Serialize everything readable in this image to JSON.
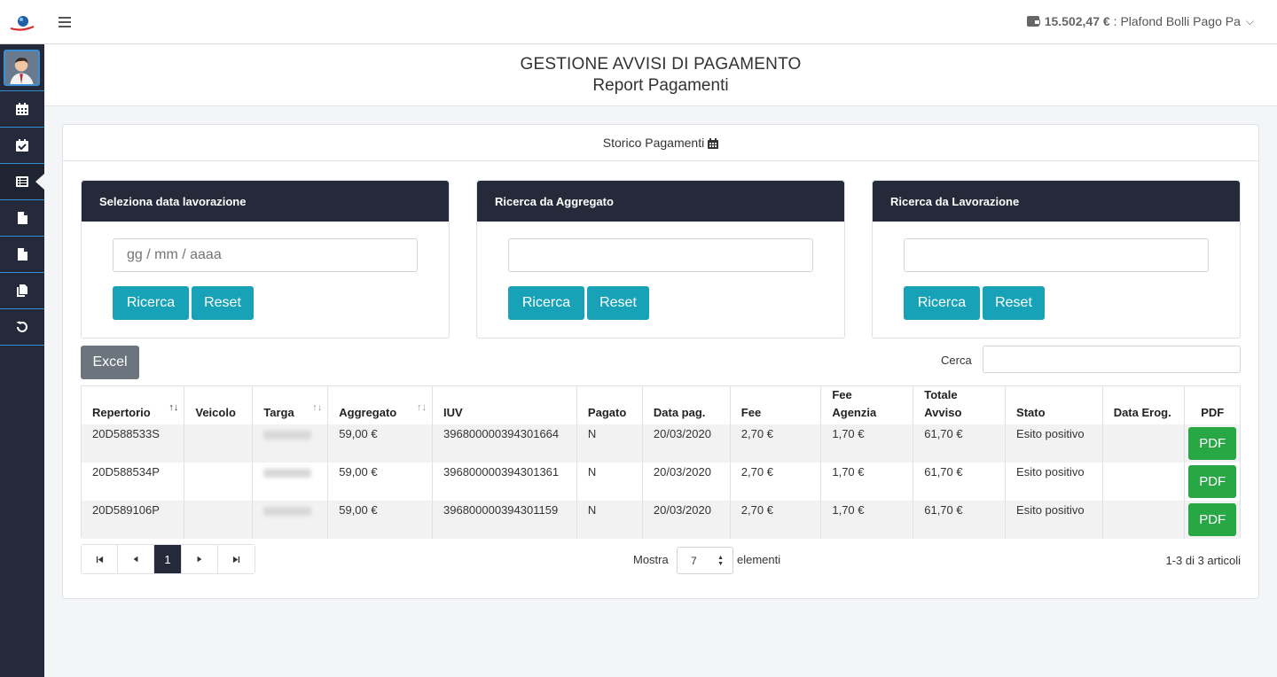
{
  "topbar": {
    "amount": "15.502,47 €",
    "plafond_label": ": Plafond Bolli Pago Pa",
    "menu_icon": "hamburger-icon",
    "wallet_icon": "wallet-icon"
  },
  "sidebar": {
    "items": [
      {
        "icon": "calendar-icon"
      },
      {
        "icon": "calendar-check-icon"
      },
      {
        "icon": "list-icon",
        "active": true
      },
      {
        "icon": "file-icon"
      },
      {
        "icon": "file-icon"
      },
      {
        "icon": "copy-icon"
      },
      {
        "icon": "undo-icon"
      }
    ]
  },
  "header": {
    "title": "GESTIONE AVVISI DI PAGAMENTO",
    "subtitle": "Report Pagamenti"
  },
  "card": {
    "title": "Storico Pagamenti"
  },
  "panels": [
    {
      "title": "Seleziona data lavorazione",
      "placeholder": "gg / mm / aaaa",
      "search_label": "Ricerca",
      "reset_label": "Reset"
    },
    {
      "title": "Ricerca da Aggregato",
      "placeholder": "",
      "search_label": "Ricerca",
      "reset_label": "Reset"
    },
    {
      "title": "Ricerca da Lavorazione",
      "placeholder": "",
      "search_label": "Ricerca",
      "reset_label": "Reset"
    }
  ],
  "toolbar": {
    "excel_label": "Excel",
    "search_label": "Cerca"
  },
  "table": {
    "columns": [
      "Repertorio",
      "Veicolo",
      "Targa",
      "Aggregato",
      "IUV",
      "Pagato",
      "Data pag.",
      "Fee",
      "Fee Agenzia",
      "Totale Avviso",
      "Stato",
      "Data Erog.",
      "PDF"
    ],
    "rows": [
      {
        "repertorio": "20D588533S",
        "veicolo": "",
        "aggregato": "59,00 €",
        "iuv": "396800000394301664",
        "pagato": "N",
        "data_pag": "20/03/2020",
        "fee": "2,70 €",
        "fee_agenzia": "1,70 €",
        "totale": "61,70 €",
        "stato": "Esito positivo",
        "data_erog": "",
        "pdf_label": "PDF"
      },
      {
        "repertorio": "20D588534P",
        "veicolo": "",
        "aggregato": "59,00 €",
        "iuv": "396800000394301361",
        "pagato": "N",
        "data_pag": "20/03/2020",
        "fee": "2,70 €",
        "fee_agenzia": "1,70 €",
        "totale": "61,70 €",
        "stato": "Esito positivo",
        "data_erog": "",
        "pdf_label": "PDF"
      },
      {
        "repertorio": "20D589106P",
        "veicolo": "",
        "aggregato": "59,00 €",
        "iuv": "396800000394301159",
        "pagato": "N",
        "data_pag": "20/03/2020",
        "fee": "2,70 €",
        "fee_agenzia": "1,70 €",
        "totale": "61,70 €",
        "stato": "Esito positivo",
        "data_erog": "",
        "pdf_label": "PDF"
      }
    ]
  },
  "pagination": {
    "first": "⏮",
    "prev": "◀",
    "current": "1",
    "next": "▶",
    "last": "⏭",
    "show_label": "Mostra",
    "page_length": "7",
    "elements_label": "elementi",
    "info": "1-3 di 3 articoli"
  }
}
